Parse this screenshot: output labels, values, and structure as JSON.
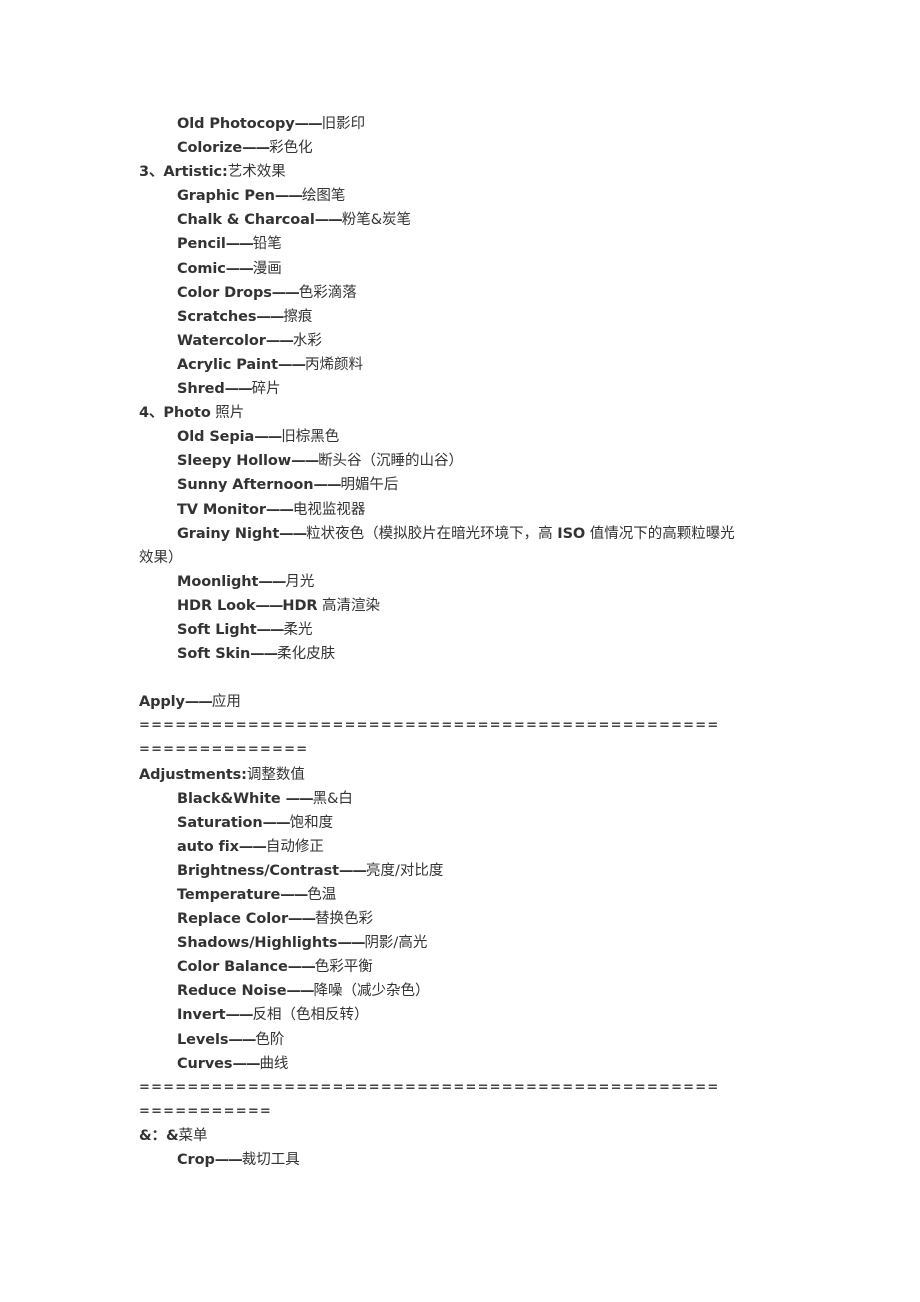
{
  "document": {
    "sections": [
      {
        "type": "items",
        "items": [
          {
            "en": "Old Photocopy",
            "sep": "——",
            "zh": "旧影印"
          },
          {
            "en": "Colorize",
            "sep": "——",
            "zh": "彩色化"
          }
        ]
      },
      {
        "type": "heading",
        "number": "3、",
        "en": "Artistic:",
        "zh": "艺术效果",
        "items": [
          {
            "en": "Graphic Pen",
            "sep": "——",
            "zh": "绘图笔"
          },
          {
            "en": "Chalk & Charcoal",
            "sep": "——",
            "zh": "粉笔&炭笔"
          },
          {
            "en": "Pencil",
            "sep": "——",
            "zh": "铅笔"
          },
          {
            "en": "Comic",
            "sep": "——",
            "zh": "漫画"
          },
          {
            "en": "Color Drops",
            "sep": "——",
            "zh": "色彩滴落"
          },
          {
            "en": "Scratches",
            "sep": "——",
            "zh": "擦痕"
          },
          {
            "en": "Watercolor",
            "sep": "——",
            "zh": "水彩"
          },
          {
            "en": "Acrylic Paint",
            "sep": "——",
            "zh": "丙烯颜料"
          },
          {
            "en": "Shred",
            "sep": "——",
            "zh": "碎片"
          }
        ]
      },
      {
        "type": "heading",
        "number": "4、",
        "en": "Photo",
        "zh": " 照片",
        "items": [
          {
            "en": "Old Sepia",
            "sep": "——",
            "zh": "旧棕黑色"
          },
          {
            "en": "Sleepy Hollow",
            "sep": "——",
            "zh": "断头谷（沉睡的山谷）"
          },
          {
            "en": "Sunny Afternoon",
            "sep": "——",
            "zh": "明媚午后"
          },
          {
            "en": "TV Monitor",
            "sep": "——",
            "zh": "电视监视器"
          },
          {
            "en": "Grainy Night",
            "sep": "——",
            "zh": "粒状夜色（模拟胶片在暗光环境下，高 ",
            "zh_bold": "ISO",
            "zh_after": " 值情况下的高颗粒曝光",
            "continuation": "效果）"
          },
          {
            "en": "Moonlight",
            "sep": "——",
            "zh": "月光"
          },
          {
            "en": "HDR Look",
            "sep": "——",
            "zh_bold_prefix": "HDR",
            "zh": " 高清渲染"
          },
          {
            "en": "Soft Light",
            "sep": "——",
            "zh": "柔光"
          },
          {
            "en": "Soft Skin",
            "sep": "——",
            "zh": "柔化皮肤"
          }
        ]
      }
    ],
    "apply": {
      "en": "Apply",
      "sep": "——",
      "zh": "应用"
    },
    "separator1": {
      "line1": "================================================",
      "line2": "=============="
    },
    "adjustments": {
      "en": "Adjustments:",
      "zh": "调整数值",
      "items": [
        {
          "en": "Black&White ",
          "sep": "——",
          "zh": "黑&白"
        },
        {
          "en": "Saturation",
          "sep": "——",
          "zh": "饱和度"
        },
        {
          "en": "auto fix",
          "sep": "——",
          "zh": "自动修正"
        },
        {
          "en": "Brightness/Contrast",
          "sep": "——",
          "zh": "亮度/对比度"
        },
        {
          "en": "Temperature",
          "sep": "——",
          "zh": "色温"
        },
        {
          "en": "Replace Color",
          "sep": "——",
          "zh": "替换色彩"
        },
        {
          "en": "Shadows/Highlights",
          "sep": "——",
          "zh": "阴影/高光"
        },
        {
          "en": "Color Balance",
          "sep": "——",
          "zh": "色彩平衡"
        },
        {
          "en": "Reduce Noise",
          "sep": "——",
          "zh": "降噪（减少杂色）"
        },
        {
          "en": "Invert",
          "sep": "——",
          "zh": "反相（色相反转）"
        },
        {
          "en": "Levels",
          "sep": "——",
          "zh": "色阶"
        },
        {
          "en": "Curves",
          "sep": "——",
          "zh": "曲线"
        }
      ]
    },
    "separator2": {
      "line1": "================================================",
      "line2": "==========="
    },
    "menu": {
      "en": "&：&",
      "zh": "菜单",
      "items": [
        {
          "en": "Crop",
          "sep": "——",
          "zh": "裁切工具"
        }
      ]
    }
  }
}
